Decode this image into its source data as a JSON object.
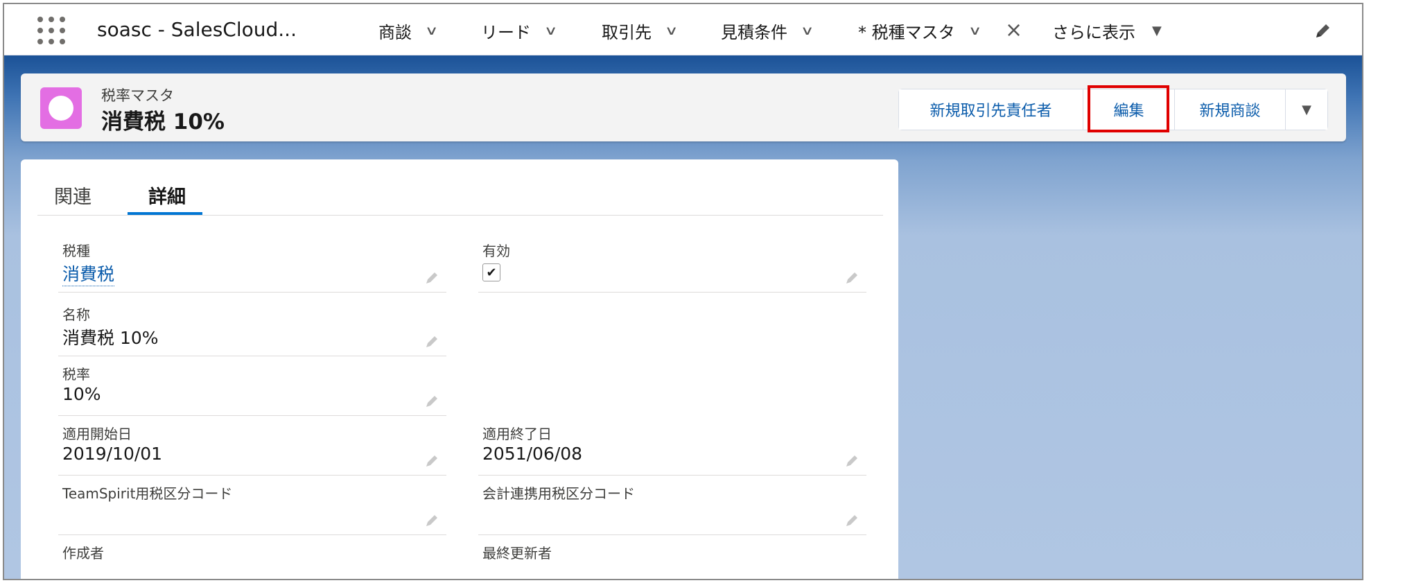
{
  "nav": {
    "app_name": "soasc - SalesCloud...",
    "items": [
      {
        "label": "商談"
      },
      {
        "label": "リード"
      },
      {
        "label": "取引先"
      },
      {
        "label": "見積条件"
      },
      {
        "label": "* 税種マスタ"
      }
    ],
    "more_label": "さらに表示"
  },
  "record": {
    "object_type": "税率マスタ",
    "title": "消費税 10%",
    "icon_color": "#e36ee3",
    "actions": {
      "new_contact": "新規取引先責任者",
      "edit": "編集",
      "new_opportunity": "新規商談"
    }
  },
  "tabs": {
    "related": "関連",
    "details": "詳細"
  },
  "fields": {
    "tax_type": {
      "label": "税種",
      "value": "消費税"
    },
    "active": {
      "label": "有効",
      "checked": true
    },
    "name": {
      "label": "名称",
      "value": "消費税 10%"
    },
    "rate": {
      "label": "税率",
      "value": "10%"
    },
    "start_date": {
      "label": "適用開始日",
      "value": "2019/10/01"
    },
    "end_date": {
      "label": "適用終了日",
      "value": "2051/06/08"
    },
    "ts_code": {
      "label": "TeamSpirit用税区分コード",
      "value": ""
    },
    "acct_code": {
      "label": "会計連携用税区分コード",
      "value": ""
    },
    "created_by": {
      "label": "作成者",
      "value": ""
    },
    "modified_by": {
      "label": "最終更新者",
      "value": ""
    }
  }
}
